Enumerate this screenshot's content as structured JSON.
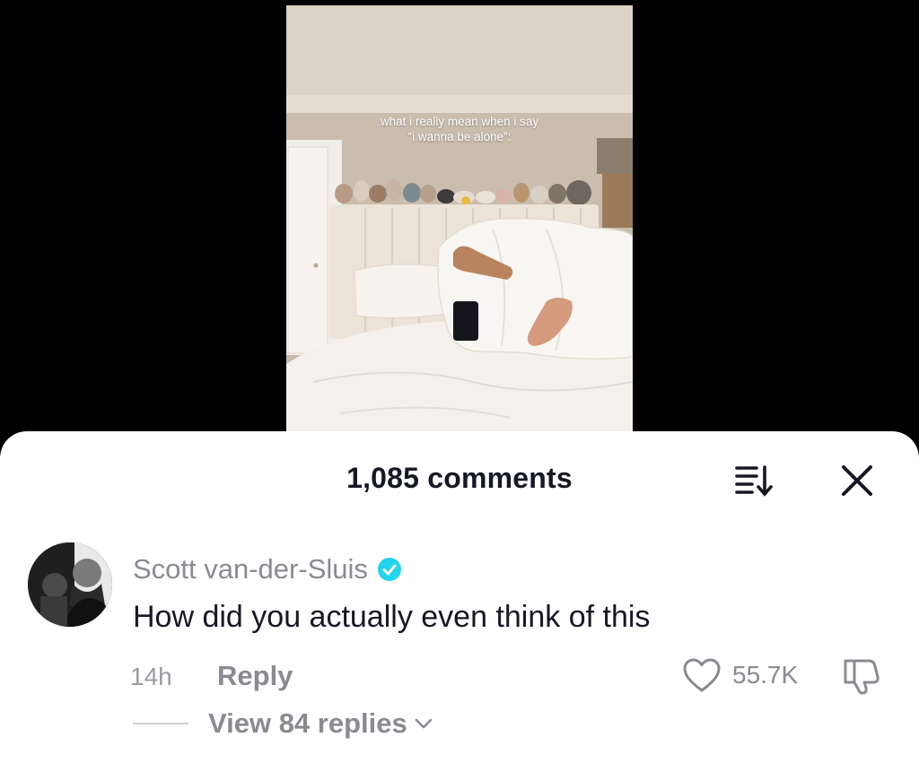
{
  "video": {
    "caption_line1": "what i really mean when i say",
    "caption_line2": "“i wanna be alone”:"
  },
  "comments_panel": {
    "title": "1,085 comments",
    "sort_icon": "sort-icon",
    "close_icon": "close-icon"
  },
  "comment": {
    "author": "Scott van-der-Sluis",
    "verified": true,
    "text": "How did you actually even think of this",
    "time": "14h",
    "reply_label": "Reply",
    "likes": "55.7K",
    "view_replies": "View 84 replies"
  },
  "colors": {
    "verified_blue": "#20d5ec",
    "primary_text": "#161823",
    "secondary_text": "#8a8b91"
  }
}
